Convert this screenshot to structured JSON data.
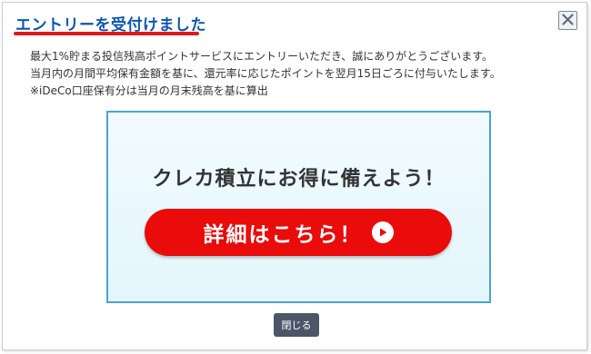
{
  "dialog": {
    "title": "エントリーを受付けました",
    "close_icon": "close-x-icon",
    "accent_color": "#0b56b0",
    "underline_color": "#e01a1a"
  },
  "message": {
    "line1": "最大1%貯まる投信残高ポイントサービスにエントリーいただき、誠にありがとうございます。",
    "line2": "当月内の月間平均保有金額を基に、還元率に応じたポイントを翌月15日ごろに付与いたします。",
    "line3": "※iDeCo口座保有分は当月の月末残高を基に算出"
  },
  "banner": {
    "heading": "クレカ積立にお得に備えよう！",
    "button_label": "詳細はこちら！",
    "button_icon": "play-circle-icon",
    "button_color": "#ea0b0b",
    "border_color": "#4aa3d6"
  },
  "footer": {
    "close_label": "閉じる"
  }
}
